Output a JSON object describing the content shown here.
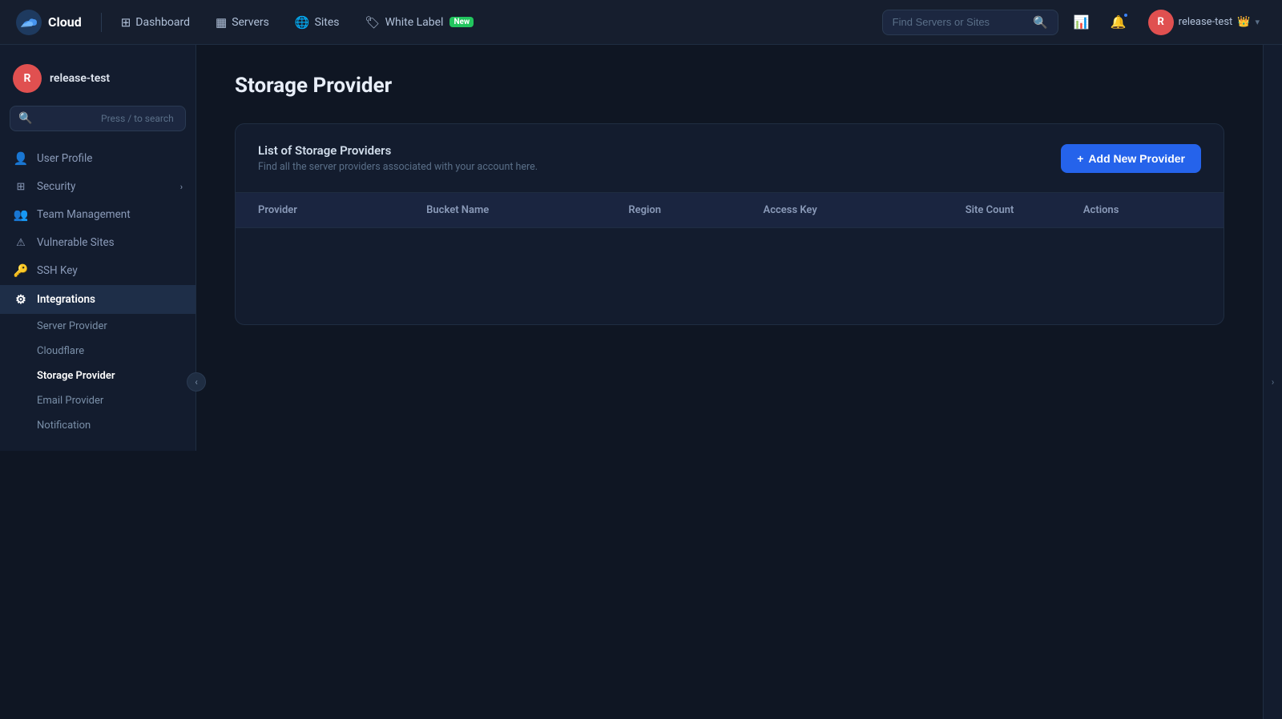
{
  "app": {
    "logo_text": "Cloud",
    "logo_icon": "☁"
  },
  "topnav": {
    "items": [
      {
        "id": "dashboard",
        "label": "Dashboard",
        "icon": "⊞"
      },
      {
        "id": "servers",
        "label": "Servers",
        "icon": "▦"
      },
      {
        "id": "sites",
        "label": "Sites",
        "icon": "🌐"
      },
      {
        "id": "white-label",
        "label": "White Label",
        "icon": "🏷",
        "badge": "New"
      }
    ],
    "search_placeholder": "Find Servers or Sites",
    "user": {
      "name": "release-test",
      "avatar_letter": "R",
      "emoji": "👑"
    }
  },
  "sidebar": {
    "user": {
      "name": "release-test",
      "avatar_letter": "R"
    },
    "search_placeholder": "Press / to search",
    "nav_items": [
      {
        "id": "user-profile",
        "label": "User Profile",
        "icon": "👤"
      },
      {
        "id": "security",
        "label": "Security",
        "icon": "⊞",
        "has_chevron": true
      },
      {
        "id": "team-management",
        "label": "Team Management",
        "icon": "👥"
      },
      {
        "id": "vulnerable-sites",
        "label": "Vulnerable Sites",
        "icon": "⚠"
      },
      {
        "id": "ssh-key",
        "label": "SSH Key",
        "icon": "🔑"
      },
      {
        "id": "integrations",
        "label": "Integrations",
        "icon": "⚙",
        "active": true
      }
    ],
    "sub_items": [
      {
        "id": "server-provider",
        "label": "Server Provider"
      },
      {
        "id": "cloudflare",
        "label": "Cloudflare"
      },
      {
        "id": "storage-provider",
        "label": "Storage Provider",
        "active": true
      },
      {
        "id": "email-provider",
        "label": "Email Provider"
      },
      {
        "id": "notification",
        "label": "Notification"
      }
    ]
  },
  "main": {
    "page_title": "Storage Provider",
    "card": {
      "title": "List of Storage Providers",
      "subtitle": "Find all the server providers associated with your account here.",
      "add_button_label": "Add New Provider"
    },
    "table": {
      "columns": [
        "Provider",
        "Bucket Name",
        "Region",
        "Access Key",
        "Site Count",
        "Actions"
      ],
      "rows": []
    }
  }
}
